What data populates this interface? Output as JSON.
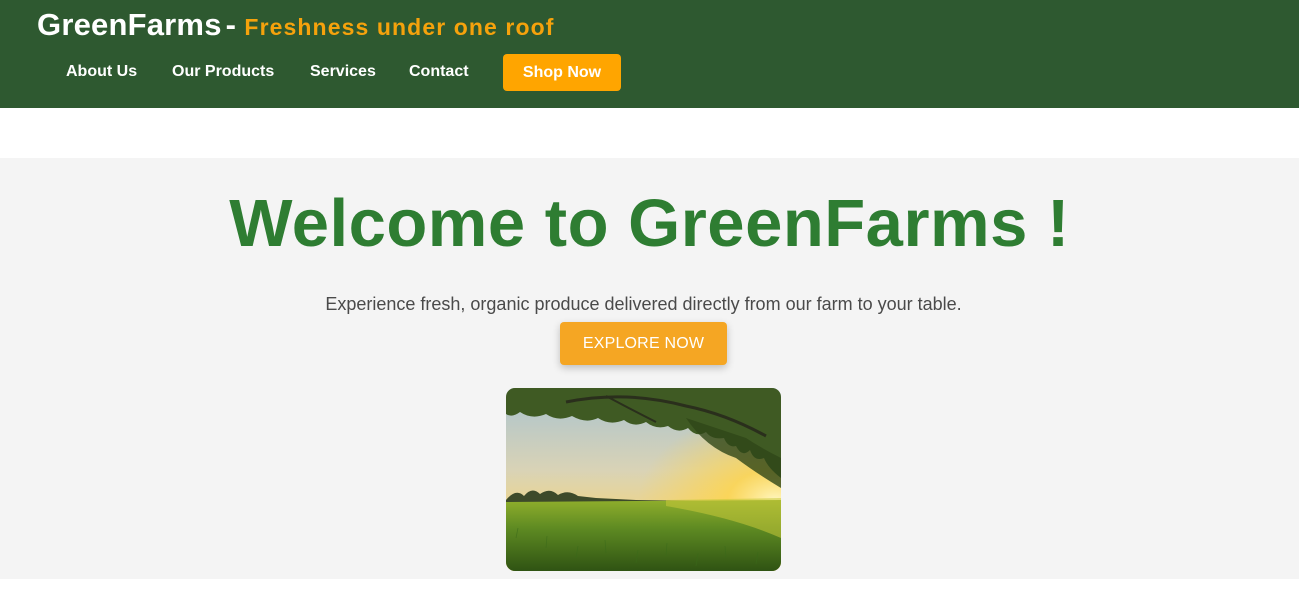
{
  "header": {
    "brand_name": "GreenFarms",
    "brand_separator": "-",
    "brand_tagline": "Freshness under one roof",
    "nav": [
      {
        "label": "About Us"
      },
      {
        "label": "Our Products"
      },
      {
        "label": "Services"
      },
      {
        "label": "Contact"
      }
    ],
    "cta_label": "Shop Now"
  },
  "hero": {
    "title": "Welcome to GreenFarms !",
    "subtitle": "Experience fresh, organic produce delivered directly from our farm to your table.",
    "button_label": "EXPLORE NOW",
    "image_icon": "farm-field-sunset-image"
  },
  "colors": {
    "header_bg": "#2e5930",
    "accent": "#ffa500",
    "title_green": "#2e7d32",
    "hero_bg": "#f4f4f4"
  }
}
